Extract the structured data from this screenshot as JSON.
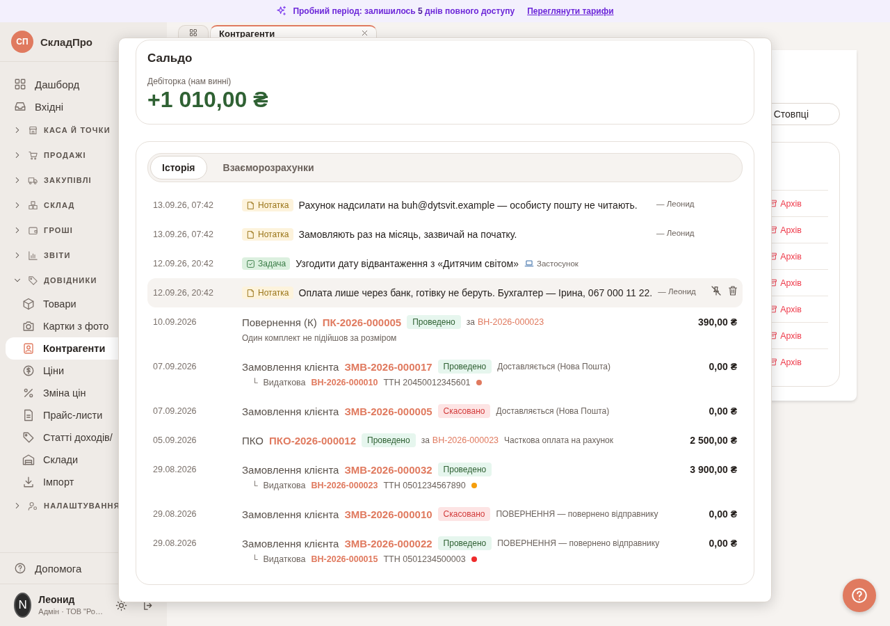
{
  "banner": {
    "text": "Пробний період: залишилось **5** днів повного доступу",
    "link": "Переглянути тарифи"
  },
  "sidebar": {
    "logo": "СП",
    "brand": "СкладПро",
    "items": [
      {
        "kind": "link",
        "label": "Дашборд",
        "selected": false
      },
      {
        "kind": "link",
        "label": "Вхідні",
        "selected": false
      },
      {
        "kind": "group",
        "label": "КАСА Й ТОЧКИ",
        "expanded": false
      },
      {
        "kind": "group",
        "label": "ПРОДАЖІ",
        "expanded": false
      },
      {
        "kind": "group",
        "label": "ЗАКУПІВЛІ",
        "expanded": false
      },
      {
        "kind": "group",
        "label": "СКЛАД",
        "expanded": false
      },
      {
        "kind": "group",
        "label": "ГРОШІ",
        "expanded": false
      },
      {
        "kind": "group",
        "label": "ЗВІТИ",
        "expanded": false
      },
      {
        "kind": "group",
        "label": "ДОВІДНИКИ",
        "expanded": true,
        "children": [
          {
            "label": "Товари",
            "selected": false
          },
          {
            "label": "Картки з фото",
            "selected": false
          },
          {
            "label": "Контрагенти",
            "selected": true
          },
          {
            "label": "Ціни",
            "selected": false
          },
          {
            "label": "Зміна цін",
            "selected": false
          },
          {
            "label": "Прайс-листи",
            "selected": false
          },
          {
            "label": "Статті доходів/",
            "selected": false
          },
          {
            "label": "Склади",
            "selected": false
          },
          {
            "label": "Імпорт",
            "selected": false
          }
        ]
      },
      {
        "kind": "group",
        "label": "НАЛАШТУВАННЯ",
        "expanded": false
      }
    ],
    "help": "Допомога",
    "user": {
      "initial": "N",
      "name": "Леонид",
      "role": "Адмін · ТОВ \"Ро…"
    }
  },
  "workspace": {
    "tabs": [
      {
        "label": "Контрагенти",
        "selected": true
      }
    ],
    "columns_button": "Стовпці",
    "archive_actions": [
      "Архів",
      "Архів",
      "Архів",
      "Архів",
      "Архів",
      "Архів",
      "Архів"
    ]
  },
  "modal": {
    "balance": {
      "title": "Сальдо",
      "label": "Дебіторка (нам винні)",
      "amount": "+1 010,00 ₴"
    },
    "history": {
      "tabs": [
        {
          "label": "Історія",
          "selected": true
        },
        {
          "label": "Взаєморозрахунки",
          "selected": false
        }
      ],
      "entries": [
        {
          "kind": "note",
          "date": "13.09.26, 07:42",
          "tag": "Нотатка",
          "text": "Рахунок надсилати на buh@dytsvit.example — особисту пошту не читають.",
          "author": "— Леонид",
          "hovered": false
        },
        {
          "kind": "note",
          "date": "13.09.26, 07:42",
          "tag": "Нотатка",
          "text": "Замовляють раз на місяць, зазвичай на початку.",
          "author": "— Леонид",
          "hovered": false
        },
        {
          "kind": "task",
          "date": "12.09.26, 20:42",
          "tag": "Задача",
          "text": "Узгодити дату відвантаження з «Дитячим світом»",
          "source": "Застосунок",
          "hovered": false
        },
        {
          "kind": "note",
          "date": "12.09.26, 20:42",
          "tag": "Нотатка",
          "text": "Оплата лише через банк, готівку не беруть. Бухгалтер — Ірина, 067 000 11 22.",
          "author": "— Леонид",
          "hovered": true
        },
        {
          "kind": "document",
          "date": "10.09.2026",
          "doc_type": "Повернення (К)",
          "number": "ПК-2026-000005",
          "status": "Проведено",
          "cancelled": false,
          "basis": {
            "prefix": "за",
            "number": "ВН-2026-000023"
          },
          "comment": "Один комплект не підійшов за розміром",
          "amount": "390,00 ₴"
        },
        {
          "kind": "document",
          "date": "07.09.2026",
          "doc_type": "Замовлення клієнта",
          "number": "ЗМВ-2026-000017",
          "status": "Проведено",
          "cancelled": false,
          "info": "Доставляється (Нова Пошта)",
          "shipment": {
            "branch": "└",
            "label": "Видаткова",
            "number": "ВН-2026-000010",
            "ttn": "ТТН 20450012345601",
            "color": "#e07a5f"
          },
          "amount": "0,00 ₴"
        },
        {
          "kind": "document",
          "date": "07.09.2026",
          "doc_type": "Замовлення клієнта",
          "number": "ЗМВ-2026-000005",
          "status": "Скасовано",
          "cancelled": true,
          "info": "Доставляється (Нова Пошта)",
          "amount": "0,00 ₴"
        },
        {
          "kind": "document",
          "date": "05.09.2026",
          "doc_type": "ПКО",
          "number": "ПКО-2026-000012",
          "status": "Проведено",
          "cancelled": false,
          "basis": {
            "prefix": "за",
            "number": "ВН-2026-000023"
          },
          "info": "Часткова оплата на рахунок",
          "amount": "2 500,00 ₴"
        },
        {
          "kind": "document",
          "date": "29.08.2026",
          "doc_type": "Замовлення клієнта",
          "number": "ЗМВ-2026-000032",
          "status": "Проведено",
          "cancelled": false,
          "shipment": {
            "branch": "└",
            "label": "Видаткова",
            "number": "ВН-2026-000023",
            "ttn": "ТТН 0501234567890",
            "color": "#f59e0b"
          },
          "amount": "3 900,00 ₴"
        },
        {
          "kind": "document",
          "date": "29.08.2026",
          "doc_type": "Замовлення клієнта",
          "number": "ЗМВ-2026-000010",
          "status": "Скасовано",
          "cancelled": true,
          "info": "ПОВЕРНЕННЯ — повернено відправнику",
          "amount": "0,00 ₴"
        },
        {
          "kind": "document",
          "date": "29.08.2026",
          "doc_type": "Замовлення клієнта",
          "number": "ЗМВ-2026-000022",
          "status": "Проведено",
          "cancelled": false,
          "info": "ПОВЕРНЕННЯ — повернено відправнику",
          "shipment": {
            "branch": "└",
            "label": "Видаткова",
            "number": "ВН-2026-000015",
            "ttn": "ТТН 0501234500003",
            "color": "#ef2b2b"
          },
          "amount": "0,00 ₴"
        }
      ]
    }
  }
}
